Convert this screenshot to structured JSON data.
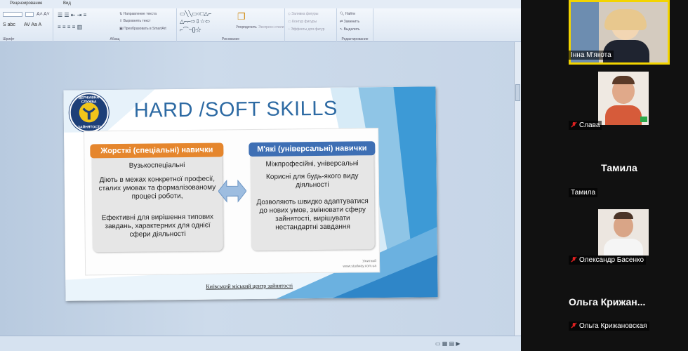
{
  "ribbon": {
    "tabs": [
      "Рецензирование",
      "Вид"
    ],
    "font_group_label": "Шрифт",
    "paragraph_group_label": "Абзац",
    "drawing_group_label": "Рисование",
    "editing_group_label": "Редактирование",
    "text_direction": "Направление текста",
    "align_text": "Выровнять текст",
    "smartart": "Преобразовать в SmartArt",
    "arrange": "Упорядочить",
    "quick_styles": "Экспресс-стили",
    "shape_fill": "Заливка фигуры",
    "shape_outline": "Контур фигуры",
    "shape_effects": "Эффекты для фигур",
    "find": "Найти",
    "replace": "Заменить",
    "select": "Выделить"
  },
  "slide": {
    "title": "HARD /SOFT SKILLS",
    "logo_top": "ДЕРЖАВНА СЛУЖБА",
    "logo_bottom": "ЗАЙНЯТОСТІ",
    "hard": {
      "header": "Жорсткі (спеціальні) навички",
      "items": [
        "Вузькоспеціальні",
        "Діють в межах конкретної професії, сталих умовах та формалізованому процесі роботи,",
        "Ефективні для вирішення типових завдань, характерних для однієї сфери діяльності"
      ]
    },
    "soft": {
      "header": "М'які (універсальні) навички",
      "items": [
        "Міжпрофесійні, універсальні",
        "Корисні для будь-якого виду діяльності",
        "Дозволяють швидко адаптуватися до нових умов, змінювати сферу зайнятості, вирішувати нестандартні завдання"
      ]
    },
    "source": [
      "Ужитний",
      "www.studway.com.ua"
    ],
    "footer": "Київський міський центр зайнятості"
  },
  "participants": [
    {
      "name": "Інна М'якота",
      "muted": false,
      "active": true
    },
    {
      "name": "Слава",
      "muted": true,
      "active": false
    },
    {
      "name": "Тамила",
      "display": "Тамила",
      "muted": false,
      "active": false
    },
    {
      "name": "Олександр Басенко",
      "muted": true,
      "active": false
    },
    {
      "name": "Ольга Крижановская",
      "display": "Ольга Крижан...",
      "muted": true,
      "active": false
    }
  ],
  "colors": {
    "hard_header": "#e5862d",
    "soft_header": "#3e6fb4",
    "title": "#2d6aa3",
    "active_border": "#f3d400",
    "mute_red": "#e02020"
  }
}
